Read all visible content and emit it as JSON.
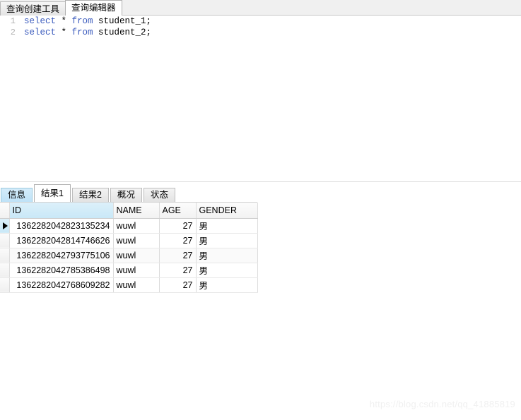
{
  "top_tabs": [
    {
      "label": "查询创建工具",
      "active": false
    },
    {
      "label": "查询编辑器",
      "active": true
    }
  ],
  "editor": {
    "lines": [
      {
        "number": "1",
        "keyword1": "select",
        "star": " * ",
        "keyword2": "from",
        "table": " student_1;"
      },
      {
        "number": "2",
        "keyword1": "select",
        "star": " * ",
        "keyword2": "from",
        "table": " student_2;"
      }
    ]
  },
  "result_tabs": [
    {
      "label": "信息",
      "state": "highlight"
    },
    {
      "label": "结果1",
      "state": "active"
    },
    {
      "label": "结果2",
      "state": "normal"
    },
    {
      "label": "概况",
      "state": "normal"
    },
    {
      "label": "状态",
      "state": "normal"
    }
  ],
  "grid": {
    "columns": [
      "ID",
      "NAME",
      "AGE",
      "GENDER"
    ],
    "selected_column": "ID",
    "current_row_index": 0,
    "rows": [
      {
        "id": "1362282042823135234",
        "name": "wuwl",
        "age": "27",
        "gender": "男"
      },
      {
        "id": "1362282042814746626",
        "name": "wuwl",
        "age": "27",
        "gender": "男"
      },
      {
        "id": "1362282042793775106",
        "name": "wuwl",
        "age": "27",
        "gender": "男"
      },
      {
        "id": "1362282042785386498",
        "name": "wuwl",
        "age": "27",
        "gender": "男"
      },
      {
        "id": "1362282042768609282",
        "name": "wuwl",
        "age": "27",
        "gender": "男"
      }
    ]
  },
  "watermark": {
    "text": "https://blog.csdn.net/qq_41885819"
  },
  "colors": {
    "keyword": "#3b5bbd",
    "tab_active_bg": "#ffffff",
    "tab_highlight_bg": "#c9e8f7",
    "header_selected_bg": "#c9e8f7",
    "grid_border": "#dcdcdc"
  }
}
